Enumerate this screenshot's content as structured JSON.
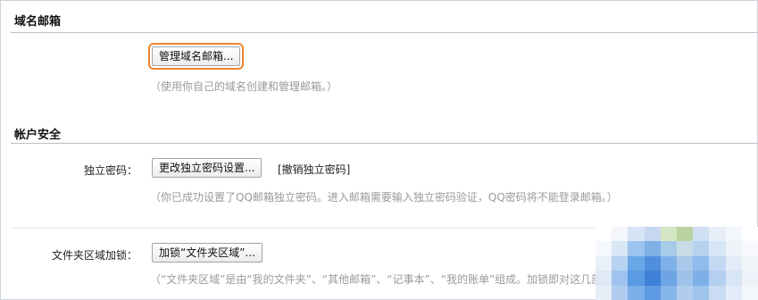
{
  "sections": {
    "domain_mail": {
      "title": "域名邮箱",
      "button_label": "管理域名邮箱...",
      "hint": "（使用你自己的域名创建和管理邮箱。）"
    },
    "account_security": {
      "title": "帐户安全",
      "password_label": "独立密码：",
      "password_button": "更改独立密码设置...",
      "revoke_link": "[撤销独立密码]",
      "password_hint": "（你已成功设置了QQ邮箱独立密码。进入邮箱需要输入独立密码验证，QQ密码将不能登录邮箱。）",
      "folder_lock_label": "文件夹区域加锁：",
      "folder_lock_button": "加锁“文件夹区域”...",
      "folder_lock_hint": "（“文件夹区域”是由“我的文件夹”、“其他邮箱”、“记事本”、“我的账单”组成。加锁即对这几部分"
    }
  },
  "colors": {
    "highlight": "#e8862d",
    "hint_text": "#9a9a9a",
    "section_line": "#b9c1cc"
  }
}
